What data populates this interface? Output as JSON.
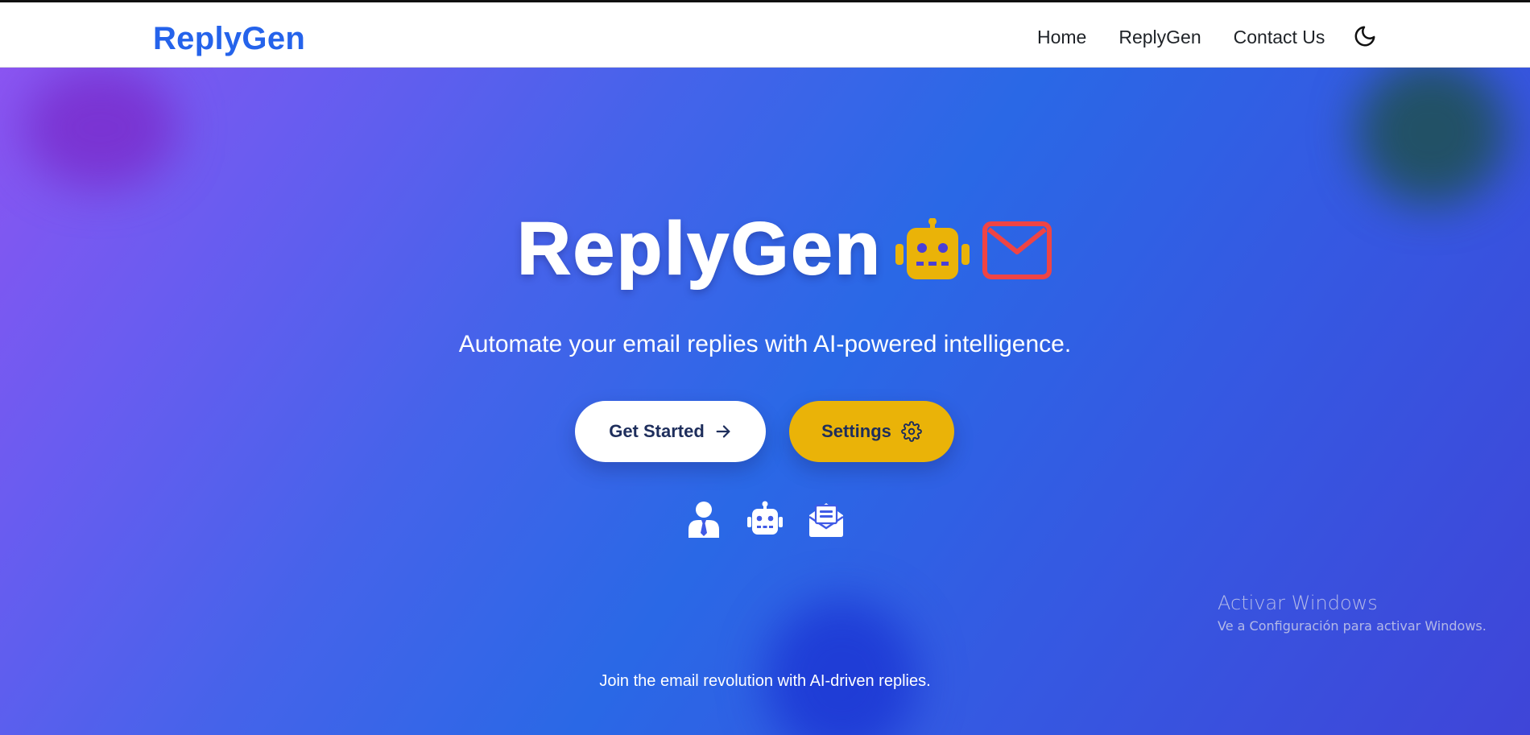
{
  "navbar": {
    "brand": "ReplyGen",
    "links": [
      "Home",
      "ReplyGen",
      "Contact Us"
    ],
    "theme_toggle_icon": "moon-icon"
  },
  "hero": {
    "title": "ReplyGen",
    "title_icons": [
      "robot-icon",
      "envelope-icon"
    ],
    "tagline": "Automate your email replies with AI-powered intelligence.",
    "buttons": {
      "get_started": "Get Started",
      "settings": "Settings"
    },
    "feature_icons": [
      "user-tie-icon",
      "robot-icon",
      "envelope-open-text-icon"
    ],
    "footer_text": "Join the email revolution with AI-driven replies."
  },
  "watermark": {
    "title": "Activar Windows",
    "subtitle": "Ve a Configuración para activar Windows."
  },
  "colors": {
    "brand": "#2563eb",
    "accent_yellow": "#eab308",
    "mail_red": "#ef4444",
    "button_text": "#1e2e5c"
  }
}
